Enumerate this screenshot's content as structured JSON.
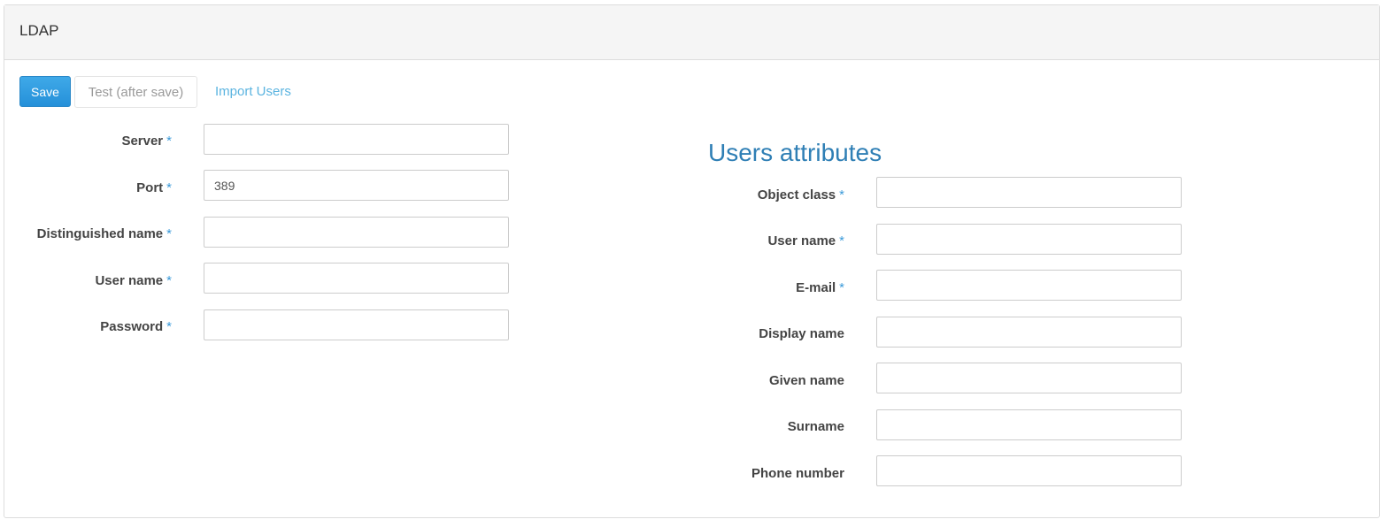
{
  "panel": {
    "title": "LDAP"
  },
  "toolbar": {
    "save_label": "Save",
    "test_label": "Test (after save)",
    "import_label": "Import Users"
  },
  "connection": {
    "server": {
      "label": "Server",
      "required": "*",
      "value": ""
    },
    "port": {
      "label": "Port",
      "required": "*",
      "value": "389"
    },
    "dn": {
      "label": "Distinguished name",
      "required": "*",
      "value": ""
    },
    "username": {
      "label": "User name",
      "required": "*",
      "value": ""
    },
    "password": {
      "label": "Password",
      "required": "*",
      "value": ""
    }
  },
  "attributes": {
    "title": "Users attributes",
    "object_class": {
      "label": "Object class",
      "required": "*",
      "value": ""
    },
    "user_name": {
      "label": "User name",
      "required": "*",
      "value": ""
    },
    "email": {
      "label": "E-mail",
      "required": "*",
      "value": ""
    },
    "display_name": {
      "label": "Display name",
      "value": ""
    },
    "given_name": {
      "label": "Given name",
      "value": ""
    },
    "surname": {
      "label": "Surname",
      "value": ""
    },
    "phone": {
      "label": "Phone number",
      "value": ""
    }
  },
  "colors": {
    "primary": "#2590d9",
    "link": "#5bb4e0",
    "required_marker": "#3a9ad9",
    "section_title": "#2f7fb5",
    "heading_bg": "#f5f5f5"
  }
}
